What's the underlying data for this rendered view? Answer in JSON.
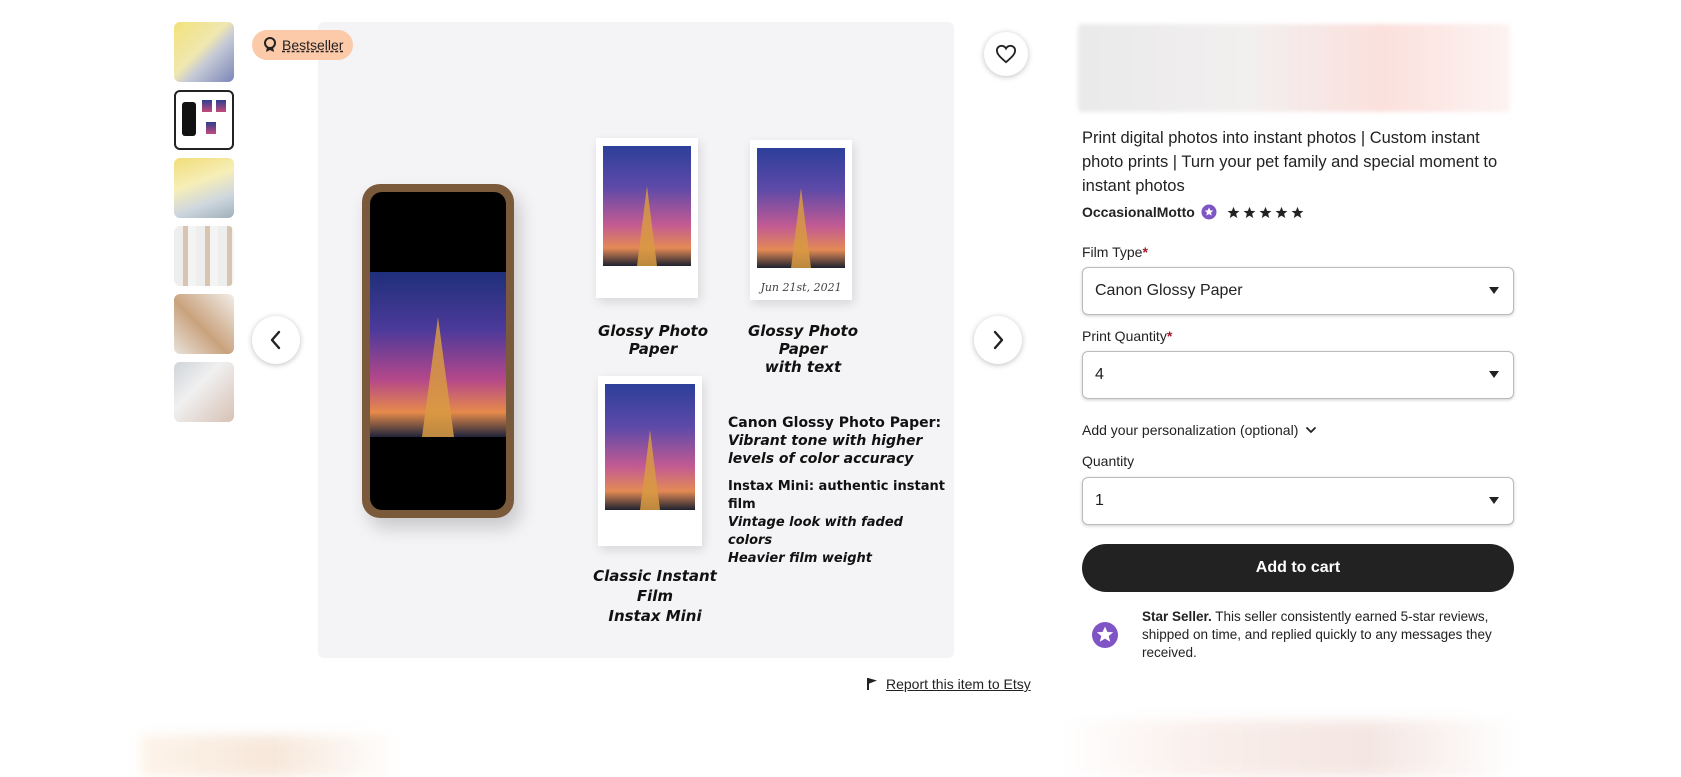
{
  "badge": {
    "label": "Bestseller",
    "icon": "ribbon-icon"
  },
  "gallery": {
    "thumbnail_count": 6,
    "active_index": 1,
    "prev_icon": "chevron-left-icon",
    "next_icon": "chevron-right-icon",
    "favorite_icon": "heart-icon"
  },
  "main_image": {
    "captions": {
      "glossy": "Glossy Photo Paper",
      "glossy_text_line1": "Glossy Photo Paper",
      "glossy_text_line2": "with text",
      "instant_line1": "Classic Instant Film",
      "instant_line2": "Instax Mini",
      "print_date": "Jun 21st, 2021"
    },
    "info": {
      "canon_heading": "Canon Glossy Photo Paper:",
      "canon_line1": "Vibrant tone with higher",
      "canon_line2": "levels of color accuracy",
      "instax_heading": "Instax Mini: authentic instant film",
      "instax_line1": "Vintage look with faded colors",
      "instax_line2": "Heavier film weight"
    }
  },
  "report": {
    "label": "Report this item to Etsy",
    "icon": "flag-icon"
  },
  "product": {
    "title": "Print digital photos into instant photos | Custom instant photo prints | Turn your pet family and special moment to instant photos",
    "shop_name": "OccasionalMotto",
    "rating": 5,
    "film_type": {
      "label": "Film Type",
      "required_mark": "*",
      "value": "Canon Glossy Paper"
    },
    "print_quantity": {
      "label": "Print Quantity",
      "required_mark": "*",
      "value": "4"
    },
    "personalization": {
      "label": "Add your personalization (optional)",
      "icon": "chevron-down-icon"
    },
    "quantity": {
      "label": "Quantity",
      "value": "1"
    },
    "add_to_cart": "Add to cart",
    "star_seller": {
      "title": "Star Seller.",
      "text": " This seller consistently earned 5-star reviews, shipped on time, and replied quickly to any messages they received."
    }
  },
  "colors": {
    "badge_bg": "#fcc9a9",
    "cart_bg": "#222222",
    "required": "#a61a2e",
    "star_seller_purple": "#7f55c5"
  }
}
